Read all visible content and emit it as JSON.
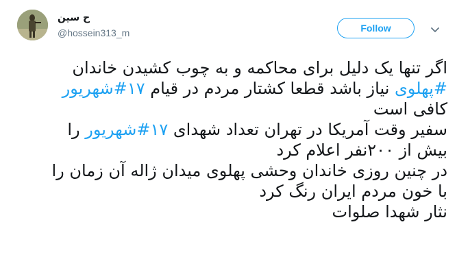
{
  "user": {
    "display_name": "ح سین",
    "handle": "@hossein313_m"
  },
  "follow_label": "Follow",
  "icons": {
    "more": "chevron-down-icon"
  },
  "accent_color": "#1da1f2",
  "tweet": {
    "line1": "اگر تنها یک دلیل برای محاکمه و به چوب کشیدن خاندان",
    "line2_hashtag_a": "#پهلوی",
    "line2_mid": " نیاز باشد قطعا کشتار مردم در قیام ",
    "line2_hashtag_b": "۱۷#شهریور",
    "line3": "کافی است",
    "line4_pre": "سفیر وقت آمریکا در تهران تعداد شهدای ",
    "line4_hashtag": "۱۷#شهریور",
    "line4_post": " را",
    "line5": "بیش از ۲۰۰نفر اعلام کرد",
    "line6": "در چنین روزی خاندان وحشی پهلوی میدان ژاله آن زمان را",
    "line7": "با خون مردم ایران رنگ کرد",
    "line8": "نثار شهدا صلوات"
  }
}
